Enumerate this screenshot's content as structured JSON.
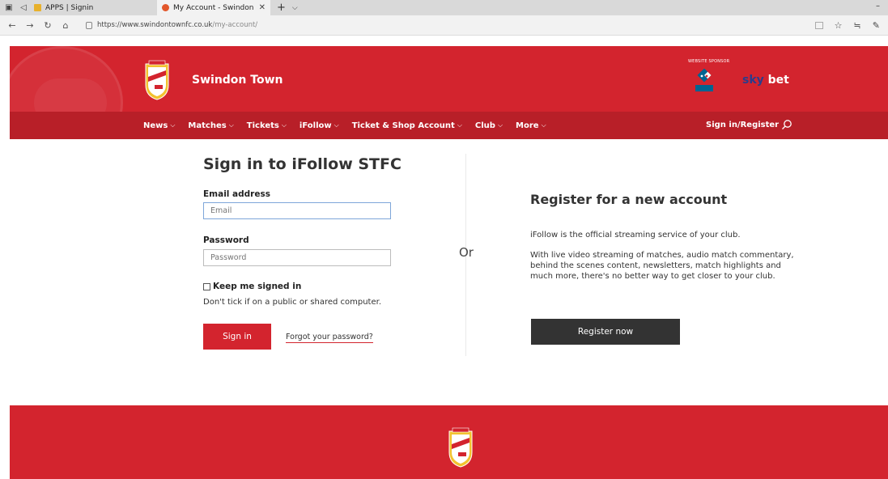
{
  "browser": {
    "tabs": [
      {
        "label": "APPS | Signin",
        "active": false
      },
      {
        "label": "My Account - Swindon",
        "active": true
      }
    ],
    "url_host": "https://www.swindontownfc.co.uk",
    "url_path": "/my-account/"
  },
  "header": {
    "title": "Swindon Town",
    "sponsor_label": "WEBSITE SPONSOR",
    "skybet_sky": "sky",
    "skybet_bet": "bet"
  },
  "nav": {
    "items": [
      {
        "label": "News"
      },
      {
        "label": "Matches"
      },
      {
        "label": "Tickets"
      },
      {
        "label": "iFollow"
      },
      {
        "label": "Ticket & Shop Account"
      },
      {
        "label": "Club"
      },
      {
        "label": "More"
      }
    ],
    "signin_label": "Sign in/Register"
  },
  "signin": {
    "heading": "Sign in to iFollow STFC",
    "email_label": "Email address",
    "email_placeholder": "Email",
    "password_label": "Password",
    "password_placeholder": "Password",
    "keep_signed_in": "Keep me signed in",
    "hint": "Don't tick if on a public or shared computer.",
    "button": "Sign in",
    "forgot": "Forgot your password?"
  },
  "or_label": "Or",
  "register": {
    "heading": "Register for a new account",
    "p1": "iFollow is the official streaming service of your club.",
    "p2": "With live video streaming of matches, audio match commentary, behind the scenes content, newsletters, match highlights and much more, there's no better way to get closer to your club.",
    "button": "Register now"
  },
  "colors": {
    "brand_red": "#d3242e",
    "nav_red": "#b81f28",
    "dark_button": "#333333"
  }
}
